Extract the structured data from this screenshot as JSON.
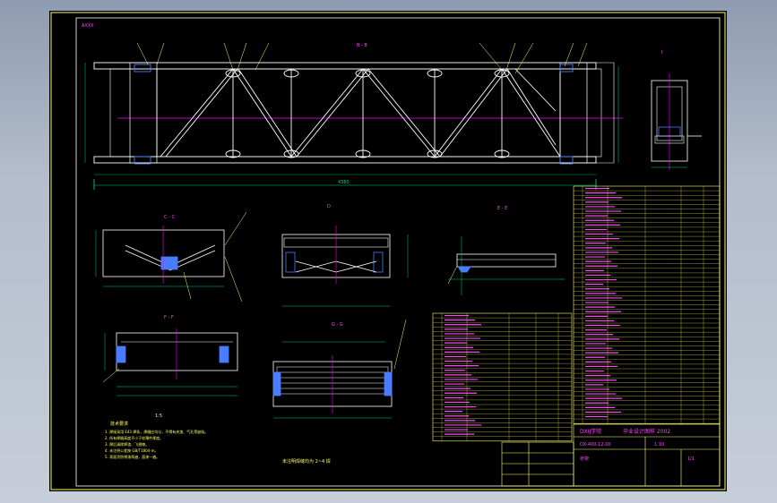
{
  "colors": {
    "viewport_bg": "#000000",
    "outline": "#ffffff",
    "border": "#ffff66",
    "dimension": "#00d27a",
    "centerline": "#ff00ff",
    "hidden": "#4a7cff",
    "leader": "#ffff66",
    "table_text": "#ff44ff",
    "table_num": "#ffff66"
  },
  "drawing": {
    "header_tag": "AXXX",
    "main_view_label": "B - B",
    "section_c_label": "C - C",
    "section_d_label": "D",
    "section_e_label": "E - E",
    "section_f_label": "F - F",
    "section_g_label": "G - G",
    "detail_label": "I",
    "overall_dimension": "4380",
    "scale_note": "1:5",
    "view_note_bottom": "未注明焊缝均为 2~4 焊",
    "tech_requirements_title": "技术要求",
    "tech_requirements": [
      "1. 焊接采用 E43 焊条，焊缝应均匀，不得有夹渣、气孔等缺陷。",
      "2. 所有焊缝高度不小于较薄件厚度。",
      "3. 焊后清除焊渣、飞溅物。",
      "4. 未注明公差按 GB/T1804-m。",
      "5. 表面涂防锈漆两遍，面漆一遍。"
    ],
    "title_block": {
      "school": "DXIJ学院",
      "project": "毕业设计图样 2002",
      "drawing_no": "DX-400-12-00",
      "scale": "1:10",
      "sheet": "1/1",
      "name": "桥架"
    }
  }
}
